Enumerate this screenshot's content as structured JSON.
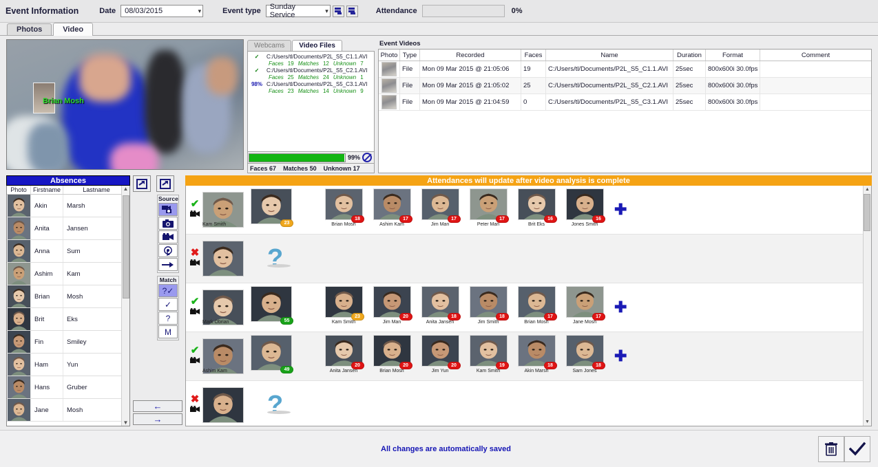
{
  "header": {
    "title": "Event Information",
    "date_label": "Date",
    "date_value": "08/03/2015",
    "event_type_label": "Event type",
    "event_type_value": "Sunday Service",
    "attendance_label": "Attendance",
    "attendance_value": "",
    "attendance_percent": "0%"
  },
  "tabs": [
    {
      "label": "Photos",
      "active": false
    },
    {
      "label": "Video",
      "active": true
    }
  ],
  "video_preview": {
    "overlay_name": "Brian Mosh"
  },
  "video_files": {
    "tabs": [
      {
        "label": "Webcams",
        "active": false
      },
      {
        "label": "Video Files",
        "active": true
      }
    ],
    "items": [
      {
        "status": "✓",
        "status_type": "check",
        "path": "C:/Users/tl/Documents/P2L_S5_C1.1.AVI",
        "faces_label": "Faces",
        "faces": "19",
        "matches_label": "Matches",
        "matches": "12",
        "unknown_label": "Unknown",
        "unknown": "7"
      },
      {
        "status": "✓",
        "status_type": "check",
        "path": "C:/Users/tl/Documents/P2L_S5_C2.1.AVI",
        "faces_label": "Faces",
        "faces": "25",
        "matches_label": "Matches",
        "matches": "24",
        "unknown_label": "Unknown",
        "unknown": "1"
      },
      {
        "status": "98%",
        "status_type": "percent",
        "path": "C:/Users/tl/Documents/P2L_S5_C3.1.AVI",
        "faces_label": "Faces",
        "faces": "23",
        "matches_label": "Matches",
        "matches": "14",
        "unknown_label": "Unknown",
        "unknown": "9"
      }
    ],
    "progress_percent": 99,
    "progress_text": "99%",
    "stop_icon": "stop-icon",
    "totals": {
      "faces_label": "Faces",
      "faces": "67",
      "matches_label": "Matches",
      "matches": "50",
      "unknown_label": "Unknown",
      "unknown": "17"
    }
  },
  "event_videos": {
    "title": "Event Videos",
    "columns": [
      "Photo",
      "Type",
      "Recorded",
      "Faces",
      "Name",
      "Duration",
      "Format",
      "Comment"
    ],
    "rows": [
      {
        "type": "File",
        "recorded": "Mon 09 Mar 2015 @ 21:05:06",
        "faces": "19",
        "name": "C:/Users/tl/Documents/P2L_S5_C1.1.AVI",
        "duration": "25sec",
        "format": "800x600i 30.0fps",
        "comment": ""
      },
      {
        "type": "File",
        "recorded": "Mon 09 Mar 2015 @ 21:05:02",
        "faces": "25",
        "name": "C:/Users/tl/Documents/P2L_S5_C2.1.AVI",
        "duration": "25sec",
        "format": "800x600i 30.0fps",
        "comment": ""
      },
      {
        "type": "File",
        "recorded": "Mon 09 Mar 2015 @ 21:04:59",
        "faces": "0",
        "name": "C:/Users/tl/Documents/P2L_S5_C3.1.AVI",
        "duration": "25sec",
        "format": "800x600i 30.0fps",
        "comment": ""
      }
    ]
  },
  "absences": {
    "title": "Absences",
    "columns": [
      "Photo",
      "Firstname",
      "Lastname"
    ],
    "rows": [
      {
        "firstname": "Akin",
        "lastname": "Marsh"
      },
      {
        "firstname": "Anita",
        "lastname": "Jansen"
      },
      {
        "firstname": "Anna",
        "lastname": "Sum"
      },
      {
        "firstname": "Ashim",
        "lastname": "Kam"
      },
      {
        "firstname": "Brian",
        "lastname": "Mosh"
      },
      {
        "firstname": "Brit",
        "lastname": "Eks"
      },
      {
        "firstname": "Fin",
        "lastname": "Smiley"
      },
      {
        "firstname": "Ham",
        "lastname": "Yun"
      },
      {
        "firstname": "Hans",
        "lastname": "Gruber"
      },
      {
        "firstname": "Jane",
        "lastname": "Mosh"
      }
    ]
  },
  "tools": {
    "export_left_icon": "export-icon",
    "export_right_icon": "export-icon",
    "source_group_label": "Source",
    "source_items": [
      {
        "icon": "camera-video-all-icon",
        "selected": true
      },
      {
        "icon": "camera-photo-icon",
        "selected": false
      },
      {
        "icon": "video-camera-icon",
        "selected": false
      },
      {
        "icon": "manual-touch-icon",
        "selected": false
      },
      {
        "icon": "arrow-right-icon",
        "selected": false
      }
    ],
    "match_group_label": "Match",
    "match_items": [
      {
        "icon": "question-check-icon",
        "label": "?✓",
        "selected": true
      },
      {
        "icon": "check-icon",
        "label": "✓",
        "selected": false
      },
      {
        "icon": "question-icon",
        "label": "?",
        "selected": false
      },
      {
        "icon": "manual-m-icon",
        "label": "M",
        "selected": false
      }
    ],
    "prev_label": "←",
    "next_label": "→"
  },
  "grid": {
    "banner": "Attendances will update after video analysis is complete",
    "rows": [
      {
        "status": "check",
        "source_name": "Kam Smith",
        "top_badge": {
          "value": "23",
          "color": "orange"
        },
        "has_plus": true,
        "candidates": [
          {
            "name": "Brian Mosh",
            "score": "18",
            "color": "red"
          },
          {
            "name": "Ashim Kam",
            "score": "17",
            "color": "red"
          },
          {
            "name": "Jim Man",
            "score": "17",
            "color": "red"
          },
          {
            "name": "Peter Man",
            "score": "17",
            "color": "red"
          },
          {
            "name": "Brit Eks",
            "score": "16",
            "color": "red"
          },
          {
            "name": "Jones Smith",
            "score": "16",
            "color": "red"
          }
        ]
      },
      {
        "status": "cross",
        "source_name": "",
        "unknown": true,
        "has_plus": false,
        "candidates": []
      },
      {
        "status": "check",
        "source_name": "Mark Obrian",
        "top_badge": {
          "value": "55",
          "color": "green"
        },
        "has_plus": true,
        "candidates": [
          {
            "name": "Kam Smith",
            "score": "23",
            "color": "orange"
          },
          {
            "name": "Jim Man",
            "score": "20",
            "color": "red"
          },
          {
            "name": "Anita Jansen",
            "score": "18",
            "color": "red"
          },
          {
            "name": "Jim Smith",
            "score": "18",
            "color": "red"
          },
          {
            "name": "Brian Mosh",
            "score": "17",
            "color": "red"
          },
          {
            "name": "Jane Mosh",
            "score": "17",
            "color": "red"
          }
        ]
      },
      {
        "status": "check",
        "source_name": "Ashim Kam",
        "top_badge": {
          "value": "49",
          "color": "green"
        },
        "has_plus": true,
        "candidates": [
          {
            "name": "Anita Jansen",
            "score": "20",
            "color": "red"
          },
          {
            "name": "Brian Mosh",
            "score": "20",
            "color": "red"
          },
          {
            "name": "Jim Yun",
            "score": "20",
            "color": "red"
          },
          {
            "name": "Kam Smith",
            "score": "19",
            "color": "red"
          },
          {
            "name": "Akin Marsh",
            "score": "18",
            "color": "red"
          },
          {
            "name": "Sam Jones",
            "score": "18",
            "color": "red"
          }
        ]
      },
      {
        "status": "cross",
        "source_name": "",
        "unknown": true,
        "has_plus": false,
        "candidates": []
      }
    ]
  },
  "bottom": {
    "save_message": "All changes are automatically saved",
    "delete_icon": "trash-icon",
    "confirm_icon": "check-icon"
  },
  "colors": {
    "accent_blue": "#1616c4",
    "banner_orange": "#f5a314",
    "badge_red": "#e01414",
    "badge_orange": "#f0a81e",
    "badge_green": "#19a319",
    "progress_green": "#13b513"
  }
}
